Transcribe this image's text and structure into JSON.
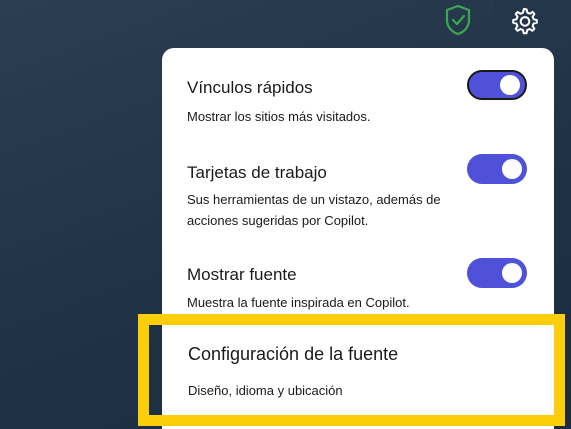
{
  "toolbar": {
    "shield_icon": "shield-check-icon",
    "settings_icon": "gear-icon"
  },
  "settings_panel": {
    "items": [
      {
        "title": "Vínculos rápidos",
        "description": "Mostrar los sitios más visitados.",
        "toggle_on": true
      },
      {
        "title": "Tarjetas de trabajo",
        "description": "Sus herramientas de un vistazo, además de acciones sugeridas por Copilot.",
        "toggle_on": true
      },
      {
        "title": "Mostrar fuente",
        "description": "Muestra la fuente inspirada en Copilot.",
        "toggle_on": true
      }
    ],
    "feed_settings": {
      "title": "Configuración de la fuente",
      "description": "Diseño, idioma y ubicación"
    }
  },
  "colors": {
    "background": "#1f3246",
    "toggle_on": "#4f52d8",
    "shield_green": "#3aa84f",
    "highlight": "#fccd09"
  }
}
